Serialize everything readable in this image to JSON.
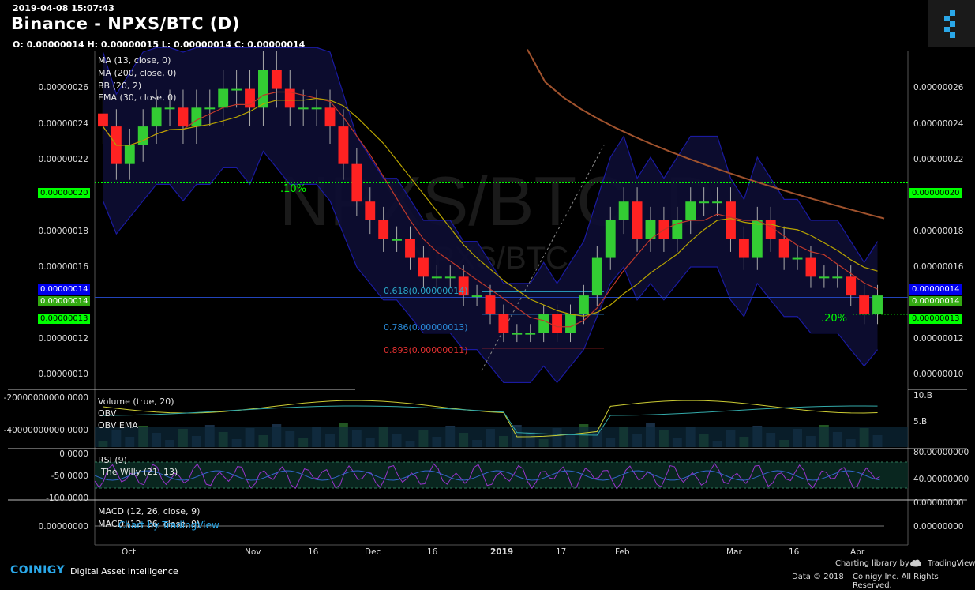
{
  "header": {
    "timestamp": "2019-04-08 15:07:43",
    "title": "Binance - NPXS/BTC (D)",
    "ohlc": "O: 0.00000014 H: 0.00000015 L: 0.00000014 C: 0.00000014"
  },
  "watermark": {
    "main": "NPXS/BTC, D",
    "secondary": "NPXS/BTC"
  },
  "legend": {
    "ma13": "MA (13, close, 0)",
    "ma200": "MA (200, close, 0)",
    "bb": "BB (20, 2)",
    "ema": "EMA (30, close, 0)"
  },
  "price_axis": {
    "ticks": [
      "0.00000026",
      "0.00000024",
      "0.00000022",
      "0.00000020",
      "0.00000018",
      "0.00000016",
      "0.00000014",
      "0.00000013",
      "0.00000012",
      "0.00000010"
    ],
    "tag_020": "0.00000020",
    "tag_014_blue": "0.00000014",
    "tag_014_green": "0.00000014",
    "tag_013": "0.00000013"
  },
  "annotations": {
    "fib_10": ".10%",
    "fib_20": ".20%",
    "fib_618": "0.618(0.00000014)",
    "fib_786": "0.786(0.00000013)",
    "fib_893": "0.893(0.00000011)"
  },
  "volume_panel": {
    "title": "Volume (true, 20)",
    "obv": "OBV",
    "obv_ema": "OBV EMA",
    "left_ticks": [
      "-20000000000.0000",
      "-40000000000.0000"
    ],
    "right_ticks": [
      "10.B",
      "5.B"
    ]
  },
  "rsi_panel": {
    "title": "RSI (9)",
    "willy": "The Willy (21, 13)",
    "left_ticks": [
      "0.0000",
      "-50.0000",
      "-100.0000"
    ],
    "right_ticks": [
      "80.00000000",
      "40.00000000",
      "0.00000000"
    ]
  },
  "macd_panel": {
    "title1": "MACD (12, 26, close, 9)",
    "title2": "MACD (12, 26, close, 9)",
    "left_tick": "0.00000000",
    "right_tick": "0.00000000",
    "tv_credit": "Chart by TradingView"
  },
  "x_axis": {
    "labels": [
      "Oct",
      "Nov",
      "16",
      "Dec",
      "16",
      "2019",
      "17",
      "Feb",
      "Mar",
      "16",
      "Apr"
    ]
  },
  "footer": {
    "brand": "COINIGY",
    "tagline": "Digital Asset Intelligence",
    "charting": "Charting library by",
    "tradingview": "TradingView",
    "copyright": "Data © 2018",
    "coinigy_inc": "Coinigy Inc. All Rights Reserved."
  },
  "colors": {
    "up": "#33cc33",
    "down": "#ff2222",
    "bb_fill": "#0d0d33",
    "bb_line": "#1a1aa0",
    "ma200": "#a0522d",
    "ma13": "#c0392b",
    "ema": "#b8a400",
    "fib_green": "#00ff00",
    "tag_blue": "#0000ee"
  },
  "chart_data": {
    "type": "candlestick",
    "price_ylim": [
      9e-08,
      2.7e-07
    ],
    "candles_close": [
      2.3e-07,
      2.1e-07,
      2.2e-07,
      2.3e-07,
      2.4e-07,
      2.4e-07,
      2.3e-07,
      2.4e-07,
      2.4e-07,
      2.5e-07,
      2.5e-07,
      2.4e-07,
      2.6e-07,
      2.5e-07,
      2.4e-07,
      2.4e-07,
      2.4e-07,
      2.3e-07,
      2.1e-07,
      1.9e-07,
      1.8e-07,
      1.7e-07,
      1.7e-07,
      1.6e-07,
      1.5e-07,
      1.5e-07,
      1.5e-07,
      1.4e-07,
      1.4e-07,
      1.3e-07,
      1.2e-07,
      1.2e-07,
      1.2e-07,
      1.3e-07,
      1.2e-07,
      1.3e-07,
      1.4e-07,
      1.6e-07,
      1.8e-07,
      1.9e-07,
      1.7e-07,
      1.8e-07,
      1.7e-07,
      1.8e-07,
      1.9e-07,
      1.9e-07,
      1.9e-07,
      1.7e-07,
      1.6e-07,
      1.8e-07,
      1.7e-07,
      1.6e-07,
      1.6e-07,
      1.5e-07,
      1.5e-07,
      1.5e-07,
      1.4e-07,
      1.3e-07,
      1.4e-07
    ],
    "ma200_desc": "declining from 0.00000027 to 0.00000018",
    "fib_levels": [
      {
        "name": "0.618",
        "value": 1.4e-07
      },
      {
        "name": "0.786",
        "value": 1.3e-07
      },
      {
        "name": "0.893",
        "value": 1.1e-07
      }
    ]
  }
}
